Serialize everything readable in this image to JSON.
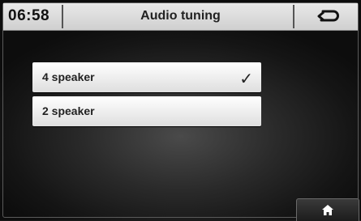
{
  "header": {
    "clock": "06:58",
    "title": "Audio tuning",
    "back_icon": "back-arrow-icon"
  },
  "options": [
    {
      "label": "4 speaker",
      "selected": true,
      "check_glyph": "✓"
    },
    {
      "label": "2 speaker",
      "selected": false
    }
  ],
  "footer": {
    "home_icon": "home-icon"
  }
}
